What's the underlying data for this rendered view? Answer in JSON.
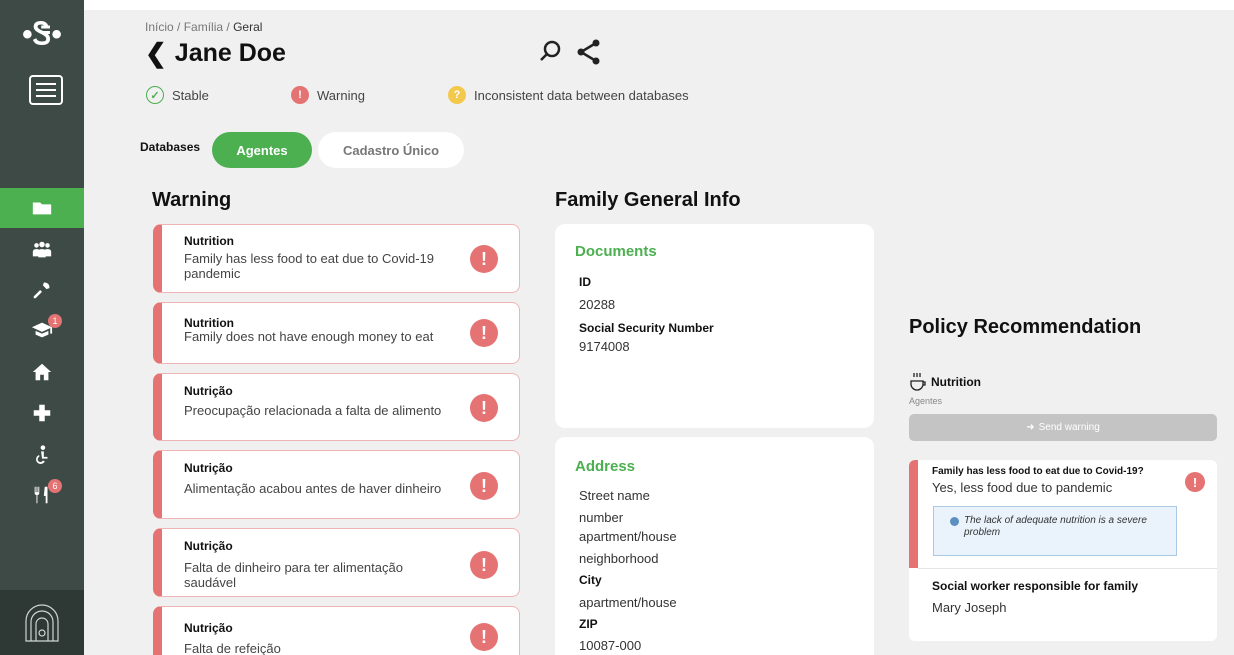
{
  "sidebar": {
    "logo": "•Ꮥ•",
    "items": [
      {
        "name": "folder-icon",
        "badge": ""
      },
      {
        "name": "family-icon",
        "badge": ""
      },
      {
        "name": "tools-icon",
        "badge": ""
      },
      {
        "name": "education-icon",
        "badge": "1"
      },
      {
        "name": "home-icon",
        "badge": ""
      },
      {
        "name": "health-icon",
        "badge": ""
      },
      {
        "name": "accessibility-icon",
        "badge": ""
      },
      {
        "name": "food-icon",
        "badge": "6"
      }
    ]
  },
  "breadcrumb": {
    "home": "Início",
    "sep1": "/",
    "family": "Família",
    "sep2": "/",
    "current": "Geral"
  },
  "page_title": "Jane Doe",
  "legend": {
    "stable": "Stable",
    "warning": "Warning",
    "inconsistent": "Inconsistent data between databases"
  },
  "databases": {
    "label": "Databases",
    "tab_active": "Agentes",
    "tab_inactive": "Cadastro Único"
  },
  "warnings": {
    "title": "Warning",
    "items": [
      {
        "category": "Nutrition",
        "text": "Family has less food to eat due to Covid-19 pandemic"
      },
      {
        "category": "Nutrition",
        "text": "Family does not have enough money to eat"
      },
      {
        "category": "Nutrição",
        "text": "Preocupação relacionada a falta de alimento"
      },
      {
        "category": "Nutrição",
        "text": "Alimentação acabou antes de haver dinheiro"
      },
      {
        "category": "Nutrição",
        "text": "Falta de dinheiro para ter alimentação saudável"
      },
      {
        "category": "Nutrição",
        "text": "Falta de refeição"
      }
    ]
  },
  "family_info": {
    "title": "Family General Info",
    "documents": {
      "heading": "Documents",
      "id_label": "ID",
      "id_value": "20288",
      "ssn_label": "Social Security Number",
      "ssn_value": "9174008"
    },
    "address": {
      "heading": "Address",
      "street": "Street name",
      "number": "number",
      "apartment": "apartment/house",
      "neighborhood": "neighborhood",
      "city_label": "City",
      "city_value": "apartment/house",
      "zip_label": "ZIP",
      "zip_value": "10087-000"
    }
  },
  "policy": {
    "title": "Policy Recommendation",
    "category": "Nutrition",
    "source": "Agentes",
    "send_button": "Send warning",
    "question": "Family has less food to eat due to Covid-19?",
    "answer": "Yes, less food due to pandemic",
    "note": "The lack of adequate nutrition is a severe problem",
    "social_worker_label": "Social worker responsible for family",
    "social_worker_name": "Mary Joseph"
  },
  "colors": {
    "sidebar": "#3d4a46",
    "accent_green": "#4caf50",
    "warning_red": "#e57373",
    "inconsistent_yellow": "#f2c94c"
  }
}
